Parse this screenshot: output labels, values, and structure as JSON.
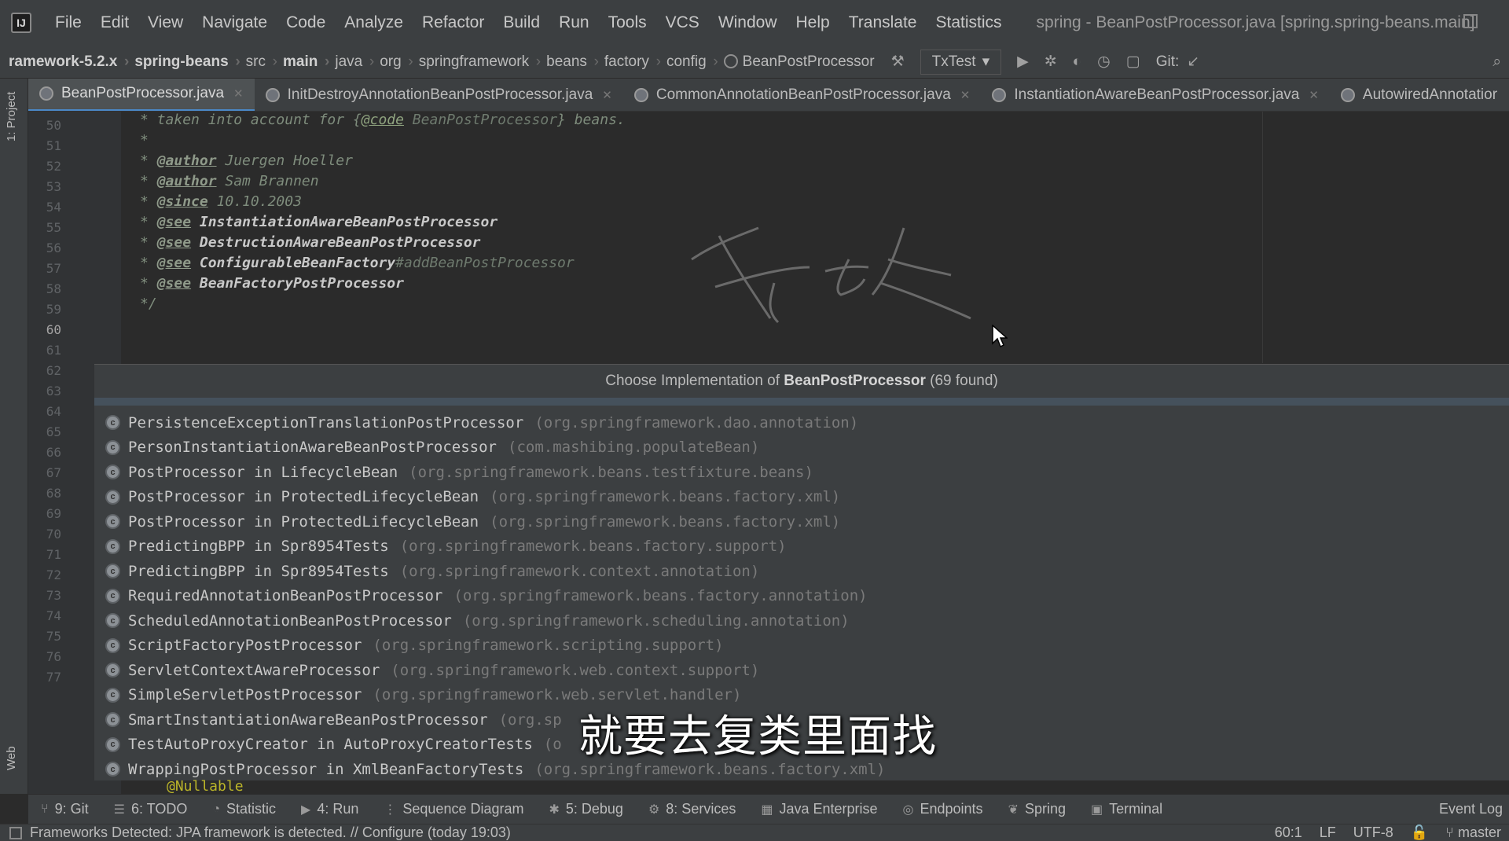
{
  "menubar": {
    "items": [
      "File",
      "Edit",
      "View",
      "Navigate",
      "Code",
      "Analyze",
      "Refactor",
      "Build",
      "Run",
      "Tools",
      "VCS",
      "Window",
      "Help",
      "Translate",
      "Statistics"
    ],
    "window_title": "spring - BeanPostProcessor.java [spring.spring-beans.main]"
  },
  "navbar": {
    "crumbs": [
      "ramework-5.2.x",
      "spring-beans",
      "src",
      "main",
      "java",
      "org",
      "springframework",
      "beans",
      "factory",
      "config",
      "BeanPostProcessor"
    ],
    "run_config": "TxTest",
    "git_label": "Git:"
  },
  "tabs": [
    {
      "label": "BeanPostProcessor.java",
      "active": true
    },
    {
      "label": "InitDestroyAnnotationBeanPostProcessor.java",
      "active": false
    },
    {
      "label": "CommonAnnotationBeanPostProcessor.java",
      "active": false
    },
    {
      "label": "InstantiationAwareBeanPostProcessor.java",
      "active": false
    },
    {
      "label": "AutowiredAnnotatior",
      "active": false
    }
  ],
  "left_strip": {
    "project": "1: Project",
    "web": "Web"
  },
  "gutter": {
    "lines": [
      "50",
      "51",
      "52",
      "53",
      "54",
      "55",
      "56",
      "57",
      "58",
      "59",
      "60",
      "61",
      "62",
      "63",
      "64",
      "65",
      "66",
      "67",
      "68",
      "69",
      "70",
      "71",
      "72",
      "73",
      "74",
      "75",
      "76",
      "77"
    ],
    "current": "60"
  },
  "editor": {
    "line50": {
      "star": "* ",
      "pre": "taken into account for {",
      "code": "@code",
      "ref": " BeanPostProcessor",
      "post": "} beans."
    },
    "line51": {
      "star": "*"
    },
    "line52": {
      "tag": "@author",
      "text": " Juergen Hoeller"
    },
    "line53": {
      "tag": "@author",
      "text": " Sam Brannen"
    },
    "line54": {
      "tag": "@since",
      "text": " 10.10.2003"
    },
    "line55": {
      "tag": "@see",
      "ref": " InstantiationAwareBeanPostProcessor"
    },
    "line56": {
      "tag": "@see",
      "ref": " DestructionAwareBeanPostProcessor"
    },
    "line57": {
      "tag": "@see",
      "ref": " ConfigurableBeanFactory",
      "dim": "#addBeanPostProcessor"
    },
    "line58": {
      "tag": "@see",
      "ref": " BeanFactoryPostProcessor"
    },
    "line59": {
      "close": "*/"
    }
  },
  "popup": {
    "title_pre": "Choose Implementation of ",
    "title_bold": "BeanPostProcessor",
    "title_post": " (69 found)",
    "items": [
      {
        "name": "PersistenceExceptionTranslationPostProcessor",
        "pkg": "(org.springframework.dao.annotation)"
      },
      {
        "name": "PersonInstantiationAwareBeanPostProcessor",
        "pkg": "(com.mashibing.populateBean)"
      },
      {
        "name": "PostProcessor in LifecycleBean",
        "pkg": "(org.springframework.beans.testfixture.beans)"
      },
      {
        "name": "PostProcessor in ProtectedLifecycleBean",
        "pkg": "(org.springframework.beans.factory.xml)"
      },
      {
        "name": "PostProcessor in ProtectedLifecycleBean",
        "pkg": "(org.springframework.beans.factory.xml)"
      },
      {
        "name": "PredictingBPP in Spr8954Tests",
        "pkg": "(org.springframework.beans.factory.support)"
      },
      {
        "name": "PredictingBPP in Spr8954Tests",
        "pkg": "(org.springframework.context.annotation)"
      },
      {
        "name": "RequiredAnnotationBeanPostProcessor",
        "pkg": "(org.springframework.beans.factory.annotation)"
      },
      {
        "name": "ScheduledAnnotationBeanPostProcessor",
        "pkg": "(org.springframework.scheduling.annotation)"
      },
      {
        "name": "ScriptFactoryPostProcessor",
        "pkg": "(org.springframework.scripting.support)"
      },
      {
        "name": "ServletContextAwareProcessor",
        "pkg": "(org.springframework.web.context.support)"
      },
      {
        "name": "SimpleServletPostProcessor",
        "pkg": "(org.springframework.web.servlet.handler)"
      },
      {
        "name": "SmartInstantiationAwareBeanPostProcessor",
        "pkg": "(org.sp"
      },
      {
        "name": "TestAutoProxyCreator in AutoProxyCreatorTests",
        "pkg": "(o"
      },
      {
        "name": "WrappingPostProcessor in XmlBeanFactoryTests",
        "pkg": "(org.springframework.beans.factory.xml)"
      }
    ]
  },
  "nullable": "@Nullable",
  "subtitle": "就要去复类里面找",
  "toolwindows": [
    {
      "icon": "⑂",
      "label": "9: Git"
    },
    {
      "icon": "☰",
      "label": "6: TODO"
    },
    {
      "icon": "◔",
      "label": "Statistic"
    },
    {
      "icon": "▶",
      "label": "4: Run"
    },
    {
      "icon": "⋮",
      "label": "Sequence Diagram"
    },
    {
      "icon": "✱",
      "label": "5: Debug"
    },
    {
      "icon": "⚙",
      "label": "8: Services"
    },
    {
      "icon": "▦",
      "label": "Java Enterprise"
    },
    {
      "icon": "◎",
      "label": "Endpoints"
    },
    {
      "icon": "❦",
      "label": "Spring"
    },
    {
      "icon": "▣",
      "label": "Terminal"
    }
  ],
  "event_log": "Event Log",
  "status": {
    "message": "Frameworks Detected: JPA framework is detected. // Configure (today 19:03)",
    "position": "60:1",
    "line_sep": "LF",
    "encoding": "UTF-8",
    "branch": "master"
  }
}
